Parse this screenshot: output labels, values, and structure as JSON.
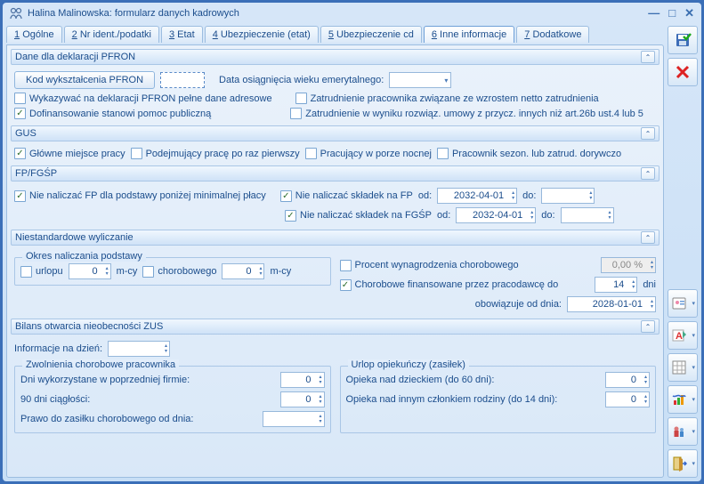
{
  "window": {
    "title": "Halina Malinowska: formularz danych kadrowych"
  },
  "tabs": [
    {
      "n": "1",
      "label": "Ogólne"
    },
    {
      "n": "2",
      "label": "Nr ident./podatki"
    },
    {
      "n": "3",
      "label": "Etat"
    },
    {
      "n": "4",
      "label": "Ubezpieczenie (etat)"
    },
    {
      "n": "5",
      "label": "Ubezpieczenie cd"
    },
    {
      "n": "6",
      "label": "Inne informacje"
    },
    {
      "n": "7",
      "label": "Dodatkowe"
    }
  ],
  "pfron": {
    "header": "Dane dla deklaracji PFRON",
    "btn": "Kod wykształcenia PFRON",
    "code": "",
    "ret_age_label": "Data osiągnięcia wieku emerytalnego:",
    "ret_age_value": "",
    "c1": "Wykazywać na deklaracji PFRON pełne dane adresowe",
    "c2": "Dofinansowanie stanowi pomoc publiczną",
    "c2_checked": true,
    "c3": "Zatrudnienie pracownika związane ze wzrostem netto zatrudnienia",
    "c4": "Zatrudnienie w wyniku rozwiąz. umowy z przycz. innych niż art.26b ust.4 lub 5"
  },
  "gus": {
    "header": "GUS",
    "c1": "Główne miejsce pracy",
    "c1_checked": true,
    "c2": "Podejmujący pracę po raz pierwszy",
    "c3": "Pracujący w porze nocnej",
    "c4": "Pracownik sezon. lub zatrud. dorywczo"
  },
  "fp": {
    "header": "FP/FGŚP",
    "c1": "Nie naliczać FP dla podstawy poniżej minimalnej płacy",
    "c1_checked": true,
    "c2": "Nie naliczać składek na FP",
    "c2_checked": true,
    "c3": "Nie naliczać składek na FGŚP",
    "c3_checked": true,
    "od": "od:",
    "do": "do:",
    "od1": "2032-04-01",
    "do1": "",
    "od2": "2032-04-01",
    "do2": ""
  },
  "nonstd": {
    "header": "Niestandardowe wyliczanie",
    "legend": "Okres naliczania podstawy",
    "urlop_label": "urlopu",
    "urlop_val": "0",
    "mcy": "m-cy",
    "chor_label": "chorobowego",
    "chor_val": "0",
    "percent_label": "Procent wynagrodzenia chorobowego",
    "percent_val": "0,00 %",
    "fin_label": "Chorobowe finansowane przez pracodawcę do",
    "fin_val": "14",
    "dni": "dni",
    "fin_checked": true,
    "obow_label": "obowiązuje od dnia:",
    "obow_val": "2028-01-01"
  },
  "zus": {
    "header": "Bilans otwarcia nieobecności ZUS",
    "info_label": "Informacje na dzień:",
    "info_val": "",
    "left_legend": "Zwolnienia chorobowe pracownika",
    "dni_label": "Dni wykorzystane w poprzedniej firmie:",
    "dni_val": "0",
    "ciag_label": "90 dni ciągłości:",
    "ciag_val": "0",
    "prawo_label": "Prawo do zasiłku chorobowego od dnia:",
    "prawo_val": "",
    "right_legend": "Urlop opiekuńczy (zasiłek)",
    "op1_label": "Opieka nad dzieckiem (do 60 dni):",
    "op1_val": "0",
    "op2_label": "Opieka nad innym członkiem rodziny (do 14 dni):",
    "op2_val": "0"
  }
}
